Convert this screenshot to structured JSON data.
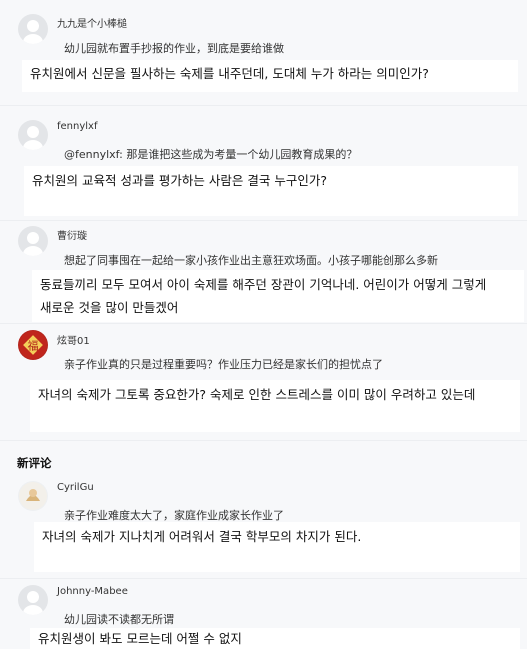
{
  "comments": [
    {
      "username": "九九是个小棒槌",
      "text": "幼儿园就布置手抄报的作业，到底是要给谁做",
      "translation": "유치원에서 신문을 필사하는 숙제를 내주던데, 도대체 누가 하라는 의미인가?"
    },
    {
      "username": "fennylxf",
      "text": "@fennylxf: 那是谁把这些成为考量一个幼儿园教育成果的？",
      "translation": "유치원의 교육적 성과를 평가하는 사람은 결국 누구인가?"
    },
    {
      "username": "曹衍璇",
      "text": "想起了同事囤在一起给一家小孩作业出主意狂欢场面。小孩子哪能创那么多新",
      "translation_lines": [
        "동료들끼리 모두 모여서 아이 숙제를 해주던 장관이 기억나네. 어린이가 어떻게 그렇게",
        "새로운 것을 많이 만들겠어"
      ]
    },
    {
      "username": "炫哥01",
      "text": "亲子作业真的只是过程重要吗？作业压力已经是家长们的担忧点了",
      "translation": "자녀의 숙제가 그토록 중요한가? 숙제로 인한 스트레스를 이미 많이 우려하고 있는데",
      "avatar_glyph": "福"
    }
  ],
  "section_title": "新评论",
  "new_comments": [
    {
      "username": "CyrilGu",
      "text": "亲子作业难度太大了，家庭作业成家长作业了",
      "translation": "자녀의 숙제가 지나치게 어려워서 결국 학부모의 차지가 된다."
    },
    {
      "username": "Johnny-Mabee",
      "text": "幼儿园读不读都无所谓",
      "translation": "유치원생이 봐도 모르는데 어쩔 수 없지"
    }
  ]
}
